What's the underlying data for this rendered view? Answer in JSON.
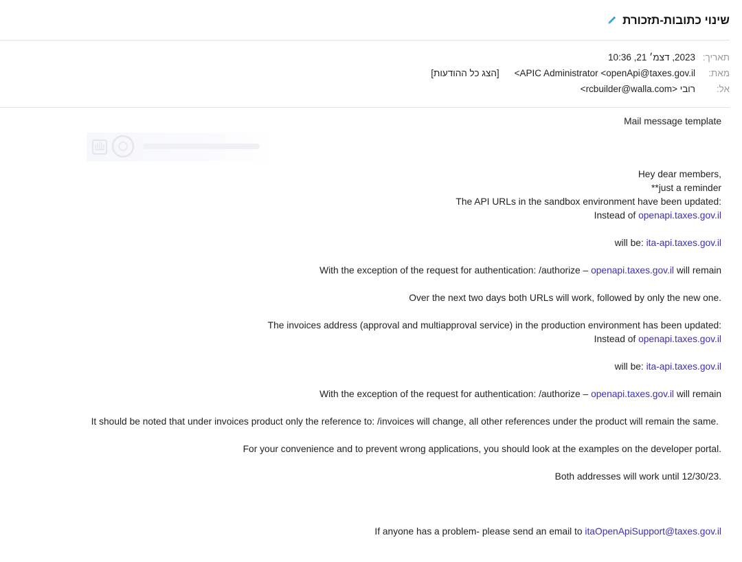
{
  "email": {
    "subject": "שינוי כתובות-תזכורת",
    "header": {
      "date_label": "תאריך:",
      "date_value": "2023, דצמ׳ 21, 10:36",
      "from_label": "מאת:",
      "from_value": "APIC Administrator <openApi@taxes.gov.il>",
      "show_all": "[הצג כל ההודעות]",
      "to_label": "אל:",
      "to_value": "רובי <rcbuilder@walla.com>"
    },
    "body": {
      "template_title": "Mail message template",
      "greeting": "Hey dear members,",
      "reminder": "**just a reminder",
      "sandbox_updated": "The API URLs in the sandbox environment have been updated:",
      "instead_of_text": "Instead of ",
      "will_be_text": "will be: ",
      "exception_text": "With the exception of the request for authentication: /authorize – ",
      "will_remain_text": " will remain",
      "next_two_days": "Over the next two days both URLs will work, followed by only the new one.",
      "invoices_updated": "The invoices address (approval and multiapproval service) in the production environment has been updated:",
      "invoices_note": "It should be noted that under invoices product only the reference to: /invoices will change, all other references under the product will remain the same.",
      "convenience": "For your convenience and to prevent wrong applications, you should look at the examples on the developer portal.",
      "both_until": "Both addresses will work until 12/30/23.",
      "problem_text": "If anyone has a problem- please send an email to ",
      "links": {
        "old_url": "openapi.taxes.gov.il",
        "new_url": "ita-api.taxes.gov.il",
        "support_email": "itaOpenApiSupport@taxes.gov.il"
      }
    }
  },
  "colors": {
    "link": "#3a2fb8",
    "edit_icon": "#35a6d8",
    "label": "#999999"
  },
  "icons": {
    "edit": "pencil-icon"
  }
}
